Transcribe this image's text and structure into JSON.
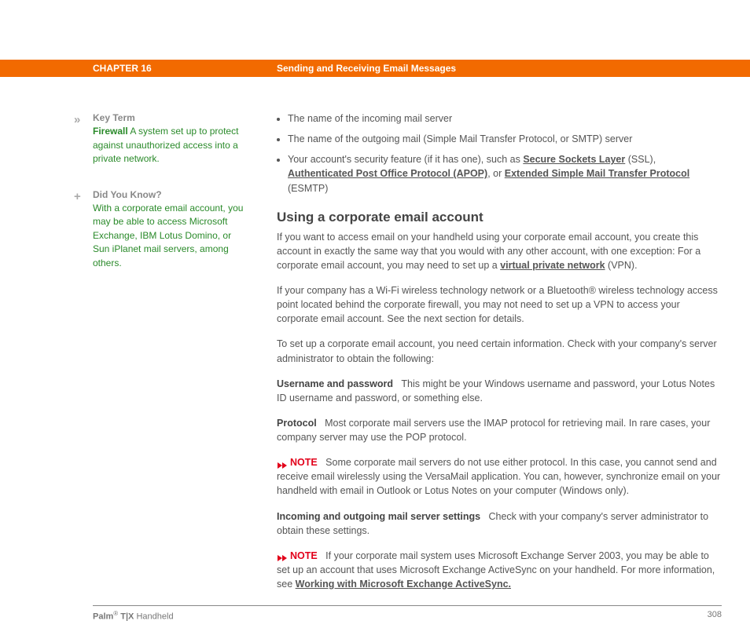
{
  "header": {
    "chapter": "CHAPTER 16",
    "title": "Sending and Receiving Email Messages"
  },
  "sidebar": {
    "keyterm": {
      "marker": "»",
      "heading": "Key Term",
      "term": "Firewall",
      "definition": "A system set up to protect against unauthorized access into a private network."
    },
    "didyouknow": {
      "marker": "+",
      "heading": "Did You Know?",
      "body": "With a corporate email account, you may be able to access Microsoft Exchange, IBM Lotus Domino, or Sun iPlanet mail servers, among others."
    }
  },
  "main": {
    "bullets": {
      "b1": "The name of the incoming mail server",
      "b2": "The name of the outgoing mail (Simple Mail Transfer Protocol, or SMTP) server",
      "b3_pre": "Your account's security feature (if it has one), such as ",
      "b3_link1": "Secure Sockets Layer",
      "b3_mid1": " (SSL), ",
      "b3_link2": "Authenticated Post Office Protocol (APOP)",
      "b3_mid2": ", or ",
      "b3_link3": "Extended Simple Mail Transfer Protocol",
      "b3_post": " (ESMTP)"
    },
    "heading": "Using a corporate email account",
    "p1_pre": "If you want to access email on your handheld using your corporate email account, you create this account in exactly the same way that you would with any other account, with one exception: For a corporate email account, you may need to set up a ",
    "p1_link": "virtual private network",
    "p1_post": " (VPN).",
    "p2": "If your company has a Wi-Fi wireless technology network or a Bluetooth® wireless technology access point located behind the corporate firewall, you may not need to set up a VPN to access your corporate email account. See the next section for details.",
    "p3": "To set up a corporate email account, you need certain information. Check with your company's server administrator to obtain the following:",
    "def1_label": "Username and password",
    "def1_body": "This might be your Windows username and password, your Lotus Notes ID username and password, or something else.",
    "def2_label": "Protocol",
    "def2_body": "Most corporate mail servers use the IMAP protocol for retrieving mail. In rare cases, your company server may use the POP protocol.",
    "note1_label": "NOTE",
    "note1_body": "Some corporate mail servers do not use either protocol. In this case, you cannot send and receive email wirelessly using the VersaMail application. You can, however, synchronize email on your handheld with email in Outlook or Lotus Notes on your computer (Windows only).",
    "def3_label": "Incoming and outgoing mail server settings",
    "def3_body": "Check with your company's server administrator to obtain these settings.",
    "note2_label": "NOTE",
    "note2_body_pre": "If your corporate mail system uses Microsoft Exchange Server 2003, you may be able to set up an account that uses Microsoft Exchange ActiveSync on your handheld. For more information, see ",
    "note2_link": "Working with Microsoft Exchange ActiveSync."
  },
  "footer": {
    "product_1": "Palm",
    "product_2": "® T|X",
    "product_3": " Handheld",
    "page": "308"
  }
}
